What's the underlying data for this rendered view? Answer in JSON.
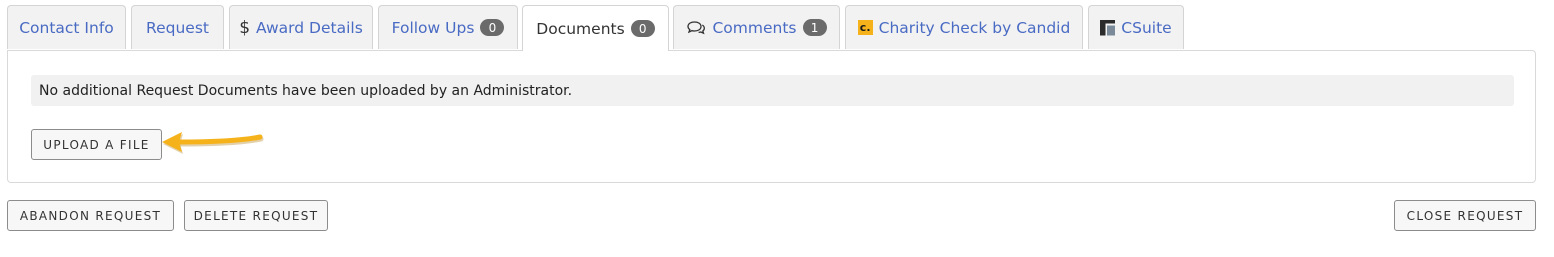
{
  "tabs": [
    {
      "label": "Contact Info"
    },
    {
      "label": "Request"
    },
    {
      "label": "Award Details",
      "icon": "dollar-icon"
    },
    {
      "label": "Follow Ups",
      "badge": "0"
    },
    {
      "label": "Documents",
      "badge": "0",
      "active": true
    },
    {
      "label": "Comments",
      "badge": "1",
      "icon": "comments-icon"
    },
    {
      "label": "Charity Check by Candid",
      "icon": "candid-logo-icon",
      "icon_text": "c."
    },
    {
      "label": "CSuite",
      "icon": "csuite-logo-icon"
    }
  ],
  "documents": {
    "notice": "No additional Request Documents have been uploaded by an Administrator.",
    "upload_label": "UPLOAD A FILE"
  },
  "actions": {
    "abandon_label": "ABANDON REQUEST",
    "delete_label": "DELETE REQUEST",
    "close_label": "CLOSE REQUEST"
  },
  "colors": {
    "link": "#4a6bc4",
    "badge": "#6b6b6b",
    "annotation_arrow": "#f5b21b",
    "candid_logo": "#f6b21a"
  }
}
